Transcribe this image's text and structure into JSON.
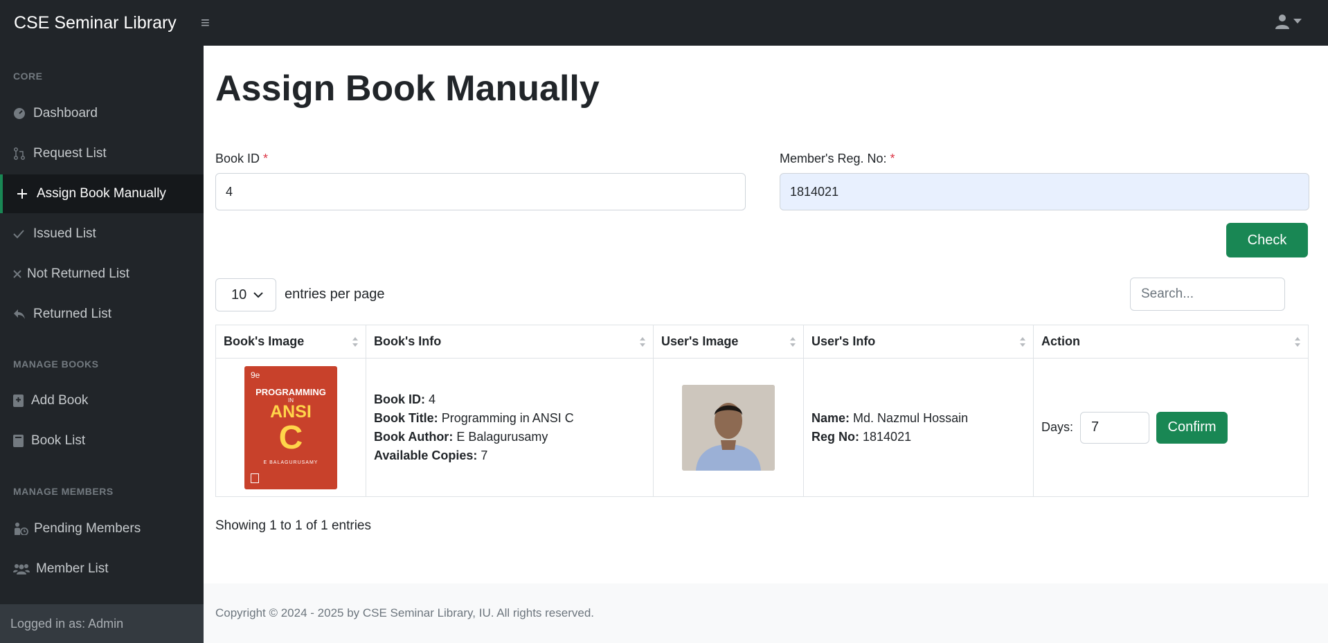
{
  "app": {
    "brand": "CSE Seminar Library"
  },
  "sidebar": {
    "sections": [
      {
        "heading": "CORE"
      },
      {
        "heading": "MANAGE BOOKS"
      },
      {
        "heading": "MANAGE MEMBERS"
      }
    ],
    "items": [
      {
        "label": "Dashboard",
        "icon": "dashboard-icon"
      },
      {
        "label": "Request List",
        "icon": "pull-request-icon"
      },
      {
        "label": "Assign Book Manually",
        "icon": "plus-icon",
        "active": true
      },
      {
        "label": "Issued List",
        "icon": "check-icon"
      },
      {
        "label": "Not Returned List",
        "icon": "x-icon"
      },
      {
        "label": "Returned List",
        "icon": "reply-icon"
      },
      {
        "label": "Add Book",
        "icon": "book-plus-icon"
      },
      {
        "label": "Book List",
        "icon": "book-icon"
      },
      {
        "label": "Pending Members",
        "icon": "pending-user-icon"
      },
      {
        "label": "Member List",
        "icon": "users-icon"
      }
    ],
    "footer": "Logged in as: Admin"
  },
  "page": {
    "title": "Assign Book Manually",
    "book_id_label": "Book ID",
    "book_id_value": "4",
    "reg_label": "Member's Reg. No:",
    "reg_value": "1814021",
    "required_mark": "*",
    "check_button": "Check"
  },
  "table_controls": {
    "per_page_value": "10",
    "per_page_label": "entries per page",
    "search_placeholder": "Search..."
  },
  "table": {
    "columns": [
      "Book's Image",
      "Book's Info",
      "User's Image",
      "User's Info",
      "Action"
    ],
    "row": {
      "book_id_label": "Book ID:",
      "book_id": "4",
      "book_title_label": "Book Title:",
      "book_title": "Programming in ANSI C",
      "book_author_label": "Book Author:",
      "book_author": "E Balagurusamy",
      "copies_label": "Available Copies:",
      "copies": "7",
      "name_label": "Name:",
      "name": "Md. Nazmul Hossain",
      "reg_label": "Reg No:",
      "reg": "1814021",
      "days_label": "Days:",
      "days_value": "7",
      "confirm_button": "Confirm"
    },
    "cover_text": {
      "edition": "9e",
      "line1": "PROGRAMMING",
      "line2": "IN",
      "line3": "ANSI",
      "line4": "C",
      "author": "E BALAGURUSAMY"
    }
  },
  "showing_text": "Showing 1 to 1 of 1 entries",
  "footer": {
    "copyright": "Copyright © 2024 - 2025 by CSE Seminar Library, IU. All rights reserved."
  },
  "colors": {
    "accent": "#198754",
    "dark": "#212529",
    "required": "#dc3545",
    "cover": "#c8412b"
  }
}
